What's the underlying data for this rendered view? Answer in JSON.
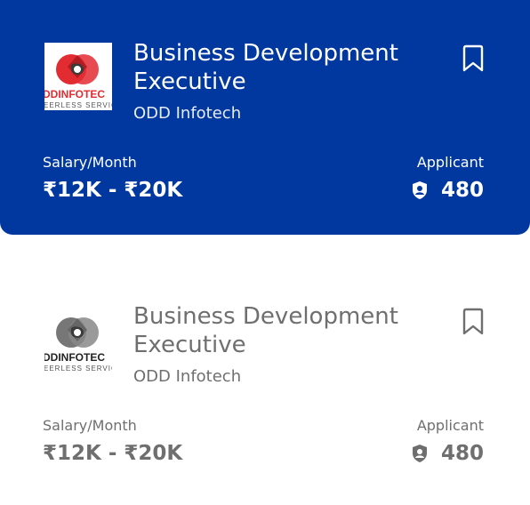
{
  "colors": {
    "active_bg": "#0038a0",
    "active_text": "#ffffff",
    "inactive_text": "#6f6f6f",
    "logo_red": "#e32b32",
    "logo_dark": "#222222",
    "logo_gray": "#777777"
  },
  "cards": [
    {
      "state": "active",
      "logo_icon": "odd-infotech-logo",
      "logo_text_main": "DDINFOTEC",
      "logo_text_sub": "EERLESS SERVIC",
      "title": "Business Development Executive",
      "company": "ODD Infotech",
      "bookmark_icon": "bookmark-icon",
      "salary_label": "Salary/Month",
      "salary_value": "₹12K - ₹20K",
      "applicant_label": "Applicant",
      "applicant_icon": "user-shield-icon",
      "applicant_count": "480"
    },
    {
      "state": "inactive",
      "logo_icon": "odd-infotech-logo-grayscale",
      "logo_text_main": "DDINFOTEC",
      "logo_text_sub": "EERLESS SERVIC",
      "title": "Business Development Executive",
      "company": "ODD Infotech",
      "bookmark_icon": "bookmark-icon",
      "salary_label": "Salary/Month",
      "salary_value": "₹12K - ₹20K",
      "applicant_label": "Applicant",
      "applicant_icon": "user-shield-icon",
      "applicant_count": "480"
    }
  ]
}
